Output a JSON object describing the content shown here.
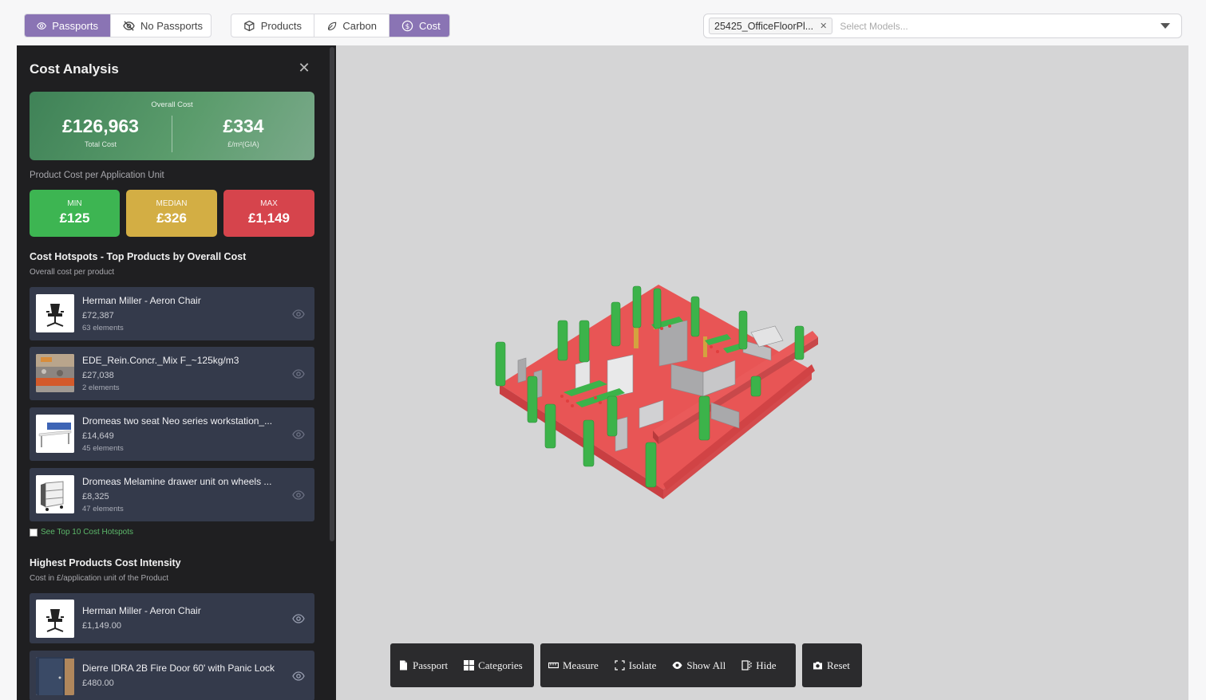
{
  "topbar": {
    "passport_toggle": [
      {
        "label": "Passports",
        "icon": "eye-icon",
        "active": true
      },
      {
        "label": "No Passports",
        "icon": "eye-off-icon",
        "active": false
      }
    ],
    "mode_toggle": [
      {
        "label": "Products",
        "icon": "box-icon",
        "active": false
      },
      {
        "label": "Carbon",
        "icon": "leaf-icon",
        "active": false
      },
      {
        "label": "Cost",
        "icon": "dollar-circle-icon",
        "active": true
      }
    ],
    "model_select": {
      "selected": "25425_OfficeFloorPl...",
      "placeholder": "Select Models..."
    }
  },
  "panel": {
    "title": "Cost Analysis",
    "overall": {
      "label": "Overall Cost",
      "total_value": "£126,963",
      "total_label": "Total Cost",
      "gia_value": "£334",
      "gia_label": "£/m²(GIA)"
    },
    "unit_subtitle": "Product Cost per Application Unit",
    "stats": [
      {
        "label": "MIN",
        "value": "£125",
        "color": "#3db552"
      },
      {
        "label": "MEDIAN",
        "value": "£326",
        "color": "#d3ae44"
      },
      {
        "label": "MAX",
        "value": "£1,149",
        "color": "#d6444c"
      }
    ],
    "hotspots": {
      "heading": "Cost Hotspots - Top Products by Overall Cost",
      "subtitle": "Overall cost per product",
      "items": [
        {
          "name": "Herman Miller - Aeron Chair",
          "value": "£72,387",
          "count": "63 elements"
        },
        {
          "name": "EDE_Rein.Concr._Mix F_~125kg/m3",
          "value": "£27,038",
          "count": "2 elements"
        },
        {
          "name": "Dromeas two seat Neo series workstation_...",
          "value": "£14,649",
          "count": "45 elements"
        },
        {
          "name": "Dromeas Melamine drawer unit on wheels ...",
          "value": "£8,325",
          "count": "47 elements"
        }
      ],
      "see_more": "See Top 10 Cost Hotspots"
    },
    "intensity": {
      "heading": "Highest Products Cost Intensity",
      "subtitle": "Cost in £/application unit of the Product",
      "items": [
        {
          "name": "Herman Miller - Aeron Chair",
          "value": "£1,149.00"
        },
        {
          "name": "Dierre IDRA 2B Fire Door 60' with Panic Lock",
          "value": "£480.00"
        }
      ]
    }
  },
  "viewer_toolbar": {
    "groups": [
      [
        {
          "label": "Passport",
          "icon": "file-icon"
        },
        {
          "label": "Categories",
          "icon": "grid-icon"
        }
      ],
      [
        {
          "label": "Measure",
          "icon": "ruler-icon"
        },
        {
          "label": "Isolate",
          "icon": "focus-icon"
        },
        {
          "label": "Show All",
          "icon": "eye-icon"
        },
        {
          "label": "Hide",
          "icon": "hide-icon"
        }
      ],
      [
        {
          "label": "Reset",
          "icon": "camera-icon"
        }
      ]
    ]
  },
  "colors": {
    "accent": "#8a74b4",
    "panel": "#1f1f21",
    "card": "#343a4b"
  }
}
